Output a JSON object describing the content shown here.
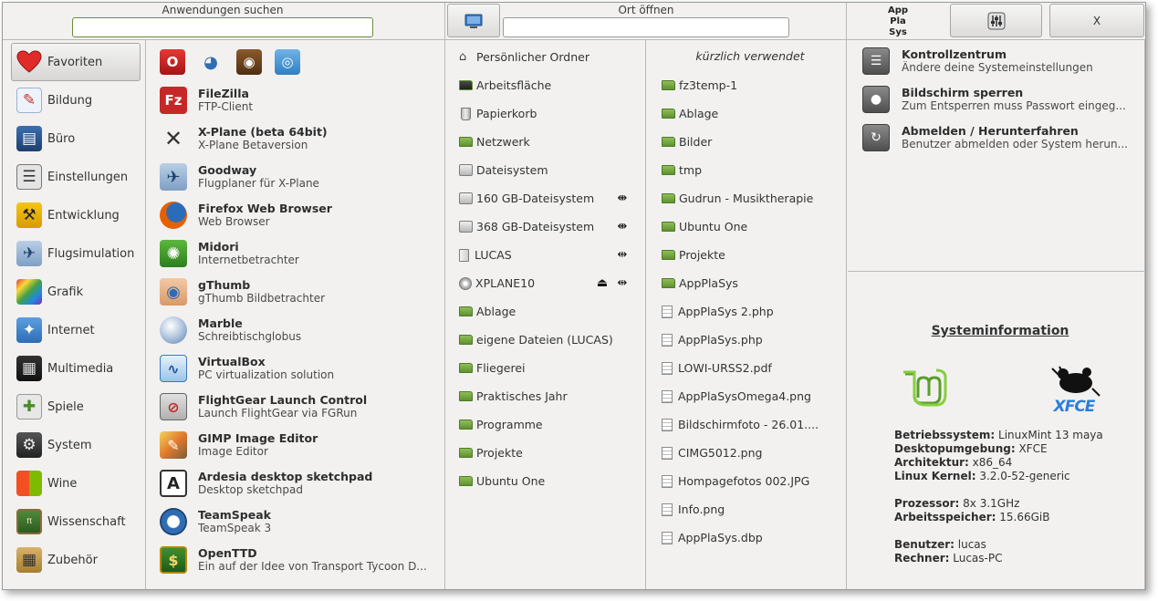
{
  "header": {
    "search_label": "Anwendungen suchen",
    "search_value": "",
    "places_label": "Ort öffnen",
    "places_value": "",
    "app_logo": [
      "App",
      "Pla",
      "Sys"
    ],
    "close_label": "X"
  },
  "categories": [
    {
      "label": "Favoriten",
      "icon": "heart-icon",
      "selected": true
    },
    {
      "label": "Bildung",
      "icon": "education-icon"
    },
    {
      "label": "Büro",
      "icon": "office-icon"
    },
    {
      "label": "Einstellungen",
      "icon": "settings-sliders-icon"
    },
    {
      "label": "Entwicklung",
      "icon": "development-icon"
    },
    {
      "label": "Flugsimulation",
      "icon": "airplane-icon"
    },
    {
      "label": "Grafik",
      "icon": "graphics-icon"
    },
    {
      "label": "Internet",
      "icon": "globe-icon"
    },
    {
      "label": "Multimedia",
      "icon": "film-icon"
    },
    {
      "label": "Spiele",
      "icon": "gamepad-icon"
    },
    {
      "label": "System",
      "icon": "system-gear-icon"
    },
    {
      "label": "Wine",
      "icon": "wine-icon"
    },
    {
      "label": "Wissenschaft",
      "icon": "science-icon"
    },
    {
      "label": "Zubehör",
      "icon": "calculator-icon"
    }
  ],
  "favorite_icons": [
    "opera-icon",
    "pidgin-icon",
    "speaker-icon",
    "network-wireless-icon"
  ],
  "apps": [
    {
      "name": "FileZilla",
      "desc": "FTP-Client",
      "icon": "filezilla-icon"
    },
    {
      "name": "X-Plane (beta 64bit)",
      "desc": "X-Plane Betaversion",
      "icon": "xplane-icon"
    },
    {
      "name": "Goodway",
      "desc": "Flugplaner für X-Plane",
      "icon": "goodway-icon"
    },
    {
      "name": "Firefox Web Browser",
      "desc": "Web Browser",
      "icon": "firefox-icon"
    },
    {
      "name": "Midori",
      "desc": "Internetbetrachter",
      "icon": "midori-icon"
    },
    {
      "name": "gThumb",
      "desc": "gThumb Bildbetrachter",
      "icon": "gthumb-icon"
    },
    {
      "name": "Marble",
      "desc": "Schreibtischglobus",
      "icon": "marble-icon"
    },
    {
      "name": "VirtualBox",
      "desc": "PC virtualization solution",
      "icon": "virtualbox-icon"
    },
    {
      "name": "FlightGear Launch Control",
      "desc": "Launch FlightGear via FGRun",
      "icon": "flightgear-icon"
    },
    {
      "name": "GIMP Image Editor",
      "desc": "Image Editor",
      "icon": "gimp-icon"
    },
    {
      "name": "Ardesia desktop sketchpad",
      "desc": "Desktop sketchpad",
      "icon": "ardesia-icon"
    },
    {
      "name": "TeamSpeak",
      "desc": "TeamSpeak 3",
      "icon": "teamspeak-icon"
    },
    {
      "name": "OpenTTD",
      "desc": "Ein auf der Idee von Transport Tycoon D...",
      "icon": "openttd-icon"
    }
  ],
  "places": [
    {
      "label": "Persönlicher Ordner",
      "icon": "home-icon"
    },
    {
      "label": "Arbeitsfläche",
      "icon": "desktop-icon"
    },
    {
      "label": "Papierkorb",
      "icon": "trash-icon"
    },
    {
      "label": "Netzwerk",
      "icon": "network-folder-icon"
    },
    {
      "label": "Dateisystem",
      "icon": "drive-icon"
    },
    {
      "label": "160 GB-Dateisystem",
      "icon": "drive-icon",
      "mount": true
    },
    {
      "label": "368 GB-Dateisystem",
      "icon": "drive-icon",
      "mount": true
    },
    {
      "label": "LUCAS",
      "icon": "usb-drive-icon",
      "unmount": true
    },
    {
      "label": "XPLANE10",
      "icon": "disc-icon",
      "eject": true,
      "unmount": true
    },
    {
      "label": "Ablage",
      "icon": "folder-icon"
    },
    {
      "label": "eigene Dateien (LUCAS)",
      "icon": "folder-icon"
    },
    {
      "label": "Fliegerei",
      "icon": "folder-icon"
    },
    {
      "label": "Praktisches Jahr",
      "icon": "folder-icon"
    },
    {
      "label": "Programme",
      "icon": "folder-icon"
    },
    {
      "label": "Projekte",
      "icon": "folder-icon"
    },
    {
      "label": "Ubuntu One",
      "icon": "folder-icon"
    }
  ],
  "recent": {
    "title": "kürzlich verwendet",
    "items": [
      {
        "label": "fz3temp-1",
        "icon": "folder-icon"
      },
      {
        "label": "Ablage",
        "icon": "folder-icon"
      },
      {
        "label": "Bilder",
        "icon": "folder-icon"
      },
      {
        "label": "tmp",
        "icon": "folder-icon"
      },
      {
        "label": "Gudrun - Musiktherapie",
        "icon": "folder-icon"
      },
      {
        "label": "Ubuntu One",
        "icon": "folder-icon"
      },
      {
        "label": "Projekte",
        "icon": "folder-icon"
      },
      {
        "label": "AppPlaSys",
        "icon": "folder-icon"
      },
      {
        "label": "AppPlaSys 2.php",
        "icon": "file-icon"
      },
      {
        "label": "AppPlaSys.php",
        "icon": "file-icon"
      },
      {
        "label": "LOWI-URSS2.pdf",
        "icon": "file-icon"
      },
      {
        "label": "AppPlaSysOmega4.png",
        "icon": "file-icon"
      },
      {
        "label": "Bildschirmfoto - 26.01....",
        "icon": "file-icon"
      },
      {
        "label": "CIMG5012.png",
        "icon": "file-icon"
      },
      {
        "label": "Hompagefotos 002.JPG",
        "icon": "file-icon"
      },
      {
        "label": "Info.png",
        "icon": "file-icon"
      },
      {
        "label": "AppPlaSys.dbp",
        "icon": "file-icon"
      }
    ]
  },
  "system_actions": [
    {
      "name": "Kontrollzentrum",
      "desc": "Ändere deine Systemeinstellungen",
      "icon": "control-center-icon"
    },
    {
      "name": "Bildschirm sperren",
      "desc": "Zum Entsperren muss Passwort eingeg...",
      "icon": "lock-icon"
    },
    {
      "name": "Abmelden / Herunterfahren",
      "desc": "Benutzer abmelden oder System herun...",
      "icon": "logout-icon"
    }
  ],
  "system_info": {
    "title": "Systeminformation",
    "logos": [
      "linux-mint-logo",
      "xfce-logo"
    ],
    "xfce_text": "XFCE",
    "rows": [
      {
        "key": "Betriebssystem:",
        "value": " LinuxMint 13 maya"
      },
      {
        "key": "Desktopumgebung:",
        "value": " XFCE"
      },
      {
        "key": "Architektur:",
        "value": " x86_64"
      },
      {
        "key": "Linux Kernel:",
        "value": " 3.2.0-52-generic"
      },
      {
        "gap": true
      },
      {
        "key": "Prozessor:",
        "value": " 8x 3.1GHz"
      },
      {
        "key": "Arbeitsspeicher:",
        "value": " 15.66GiB"
      },
      {
        "gap": true
      },
      {
        "key": "Benutzer:",
        "value": " lucas"
      },
      {
        "key": "Rechner:",
        "value": " Lucas-PC"
      }
    ]
  },
  "colors": {
    "background": "#f2f1f0",
    "separator": "#b9b9b9",
    "search_border": "#6b8e3c",
    "folder_green": "#7aab45",
    "mint_green": "#87cf3e"
  }
}
